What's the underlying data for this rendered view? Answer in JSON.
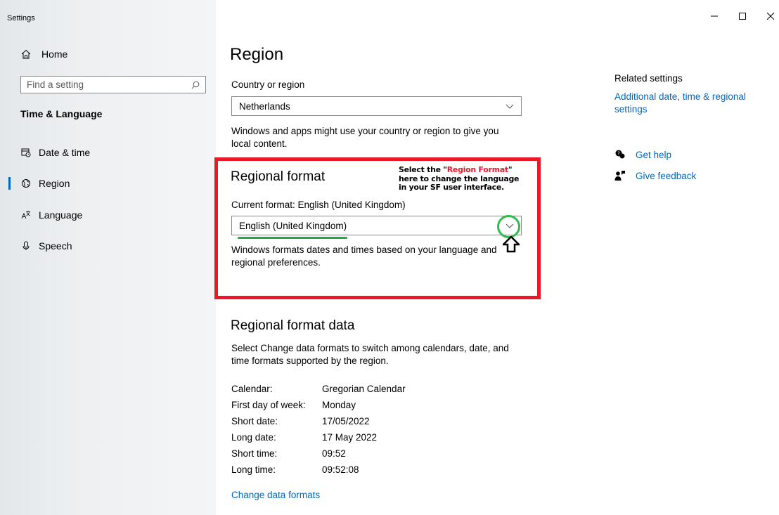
{
  "window": {
    "app_title": "Settings",
    "controls": {
      "minimize": "minimize-icon",
      "maximize": "maximize-icon",
      "close": "close-icon"
    }
  },
  "sidebar": {
    "home_label": "Home",
    "search_placeholder": "Find a setting",
    "section_title": "Time & Language",
    "items": [
      {
        "label": "Date & time",
        "icon": "calendar-clock-icon",
        "active": false
      },
      {
        "label": "Region",
        "icon": "globe-icon",
        "active": true
      },
      {
        "label": "Language",
        "icon": "language-icon",
        "active": false
      },
      {
        "label": "Speech",
        "icon": "microphone-icon",
        "active": false
      }
    ]
  },
  "main": {
    "page_title": "Region",
    "country_label": "Country or region",
    "country_value": "Netherlands",
    "country_desc_line1": "Windows and apps might use your country or region to give you",
    "country_desc_line2": "local content.",
    "regional_format_title": "Regional format",
    "current_format": "Current format: English (United Kingdom)",
    "format_value": "English (United Kingdom)",
    "format_desc_line1": "Windows formats dates and times based on your language and",
    "format_desc_line2": "regional preferences.",
    "format_data_title": "Regional format data",
    "format_data_desc_line1": "Select Change data formats to switch among calendars, date, and",
    "format_data_desc_line2": "time formats supported by the region.",
    "format_data_rows": [
      {
        "key": "Calendar:",
        "value": "Gregorian Calendar"
      },
      {
        "key": "First day of week:",
        "value": "Monday"
      },
      {
        "key": "Short date:",
        "value": "17/05/2022"
      },
      {
        "key": "Long date:",
        "value": "17 May 2022"
      },
      {
        "key": "Short time:",
        "value": "09:52"
      },
      {
        "key": "Long time:",
        "value": "09:52:08"
      }
    ],
    "change_formats_link": "Change data formats"
  },
  "annotation": {
    "line1_prefix": "Select the \"",
    "line1_highlight": "Region Format",
    "line1_suffix": "\"",
    "line2": "here to change the language",
    "line3": "in your SF user interface.",
    "colors": {
      "box": "#e81a2a",
      "highlight": "#e81a2a",
      "circle": "#2ebd4e",
      "underline": "#22a84a"
    }
  },
  "related": {
    "title": "Related settings",
    "link": "Additional date, time & regional settings",
    "help": "Get help",
    "feedback": "Give feedback"
  },
  "colors": {
    "accent": "#0067c0"
  }
}
